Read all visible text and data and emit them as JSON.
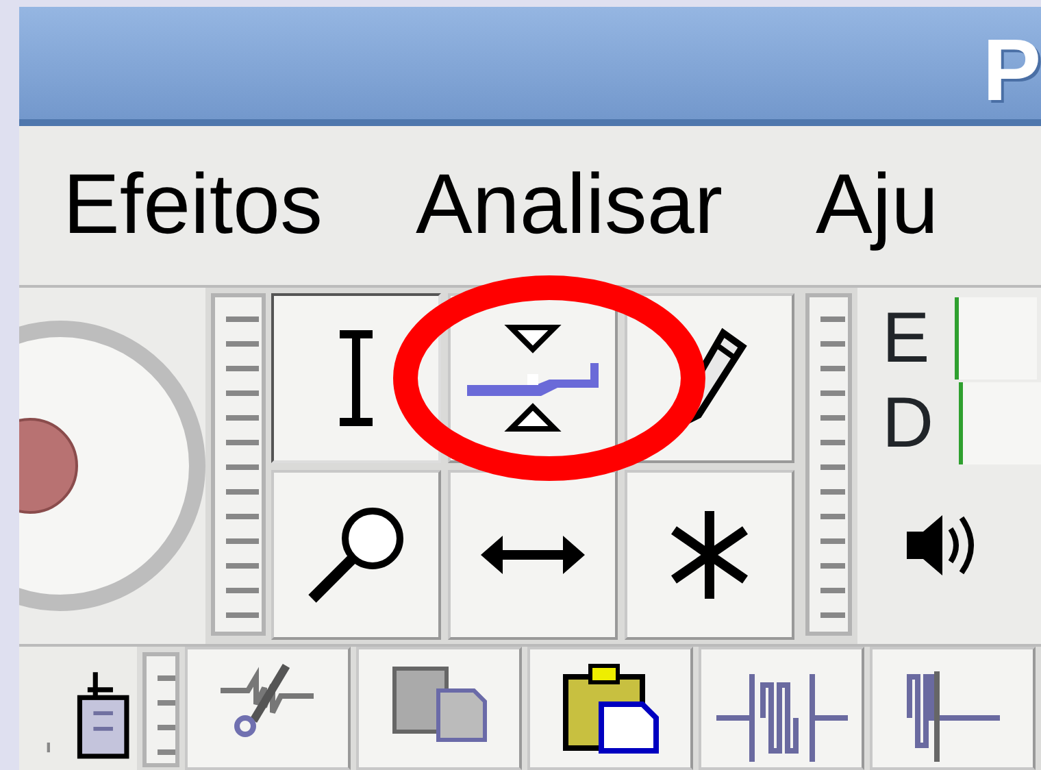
{
  "window": {
    "title": "P"
  },
  "menu": [
    {
      "label": "Efeitos"
    },
    {
      "label": "Analisar"
    },
    {
      "label": "Aju"
    }
  ],
  "tools": [
    {
      "kind": "selection",
      "selected": true
    },
    {
      "kind": "envelope",
      "selected": false
    },
    {
      "kind": "draw",
      "selected": false
    },
    {
      "kind": "zoom",
      "selected": false
    },
    {
      "kind": "timeshift",
      "selected": false
    },
    {
      "kind": "multi",
      "selected": false
    }
  ],
  "meter": {
    "channels": [
      {
        "label": "E"
      },
      {
        "label": "D"
      }
    ]
  },
  "edit_tools": [
    {
      "kind": "cut"
    },
    {
      "kind": "copy"
    },
    {
      "kind": "paste"
    },
    {
      "kind": "trim"
    },
    {
      "kind": "silence"
    }
  ]
}
